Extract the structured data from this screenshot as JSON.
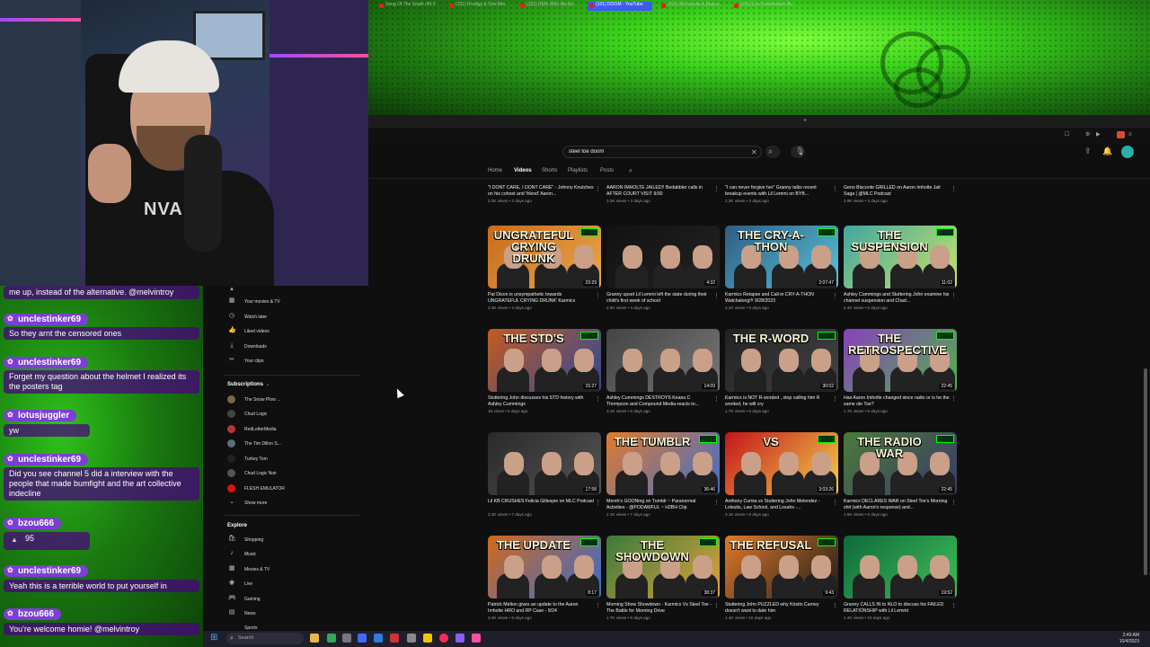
{
  "browser": {
    "tabs": [
      {
        "label": "Song Of The South (4K F"
      },
      {
        "label": "(101) Prodigy & Tom Mor"
      },
      {
        "label": "(101) DMX-Who We Be -"
      },
      {
        "label": "(101) DOOM - YouTube"
      },
      {
        "label": "(101) Minnesota is Basica"
      },
      {
        "label": "(101) Eye Examination Bu"
      }
    ]
  },
  "search": {
    "value": "steel toe doom"
  },
  "channel_tabs": [
    "Home",
    "Videos",
    "Shorts",
    "Playlists",
    "Posts"
  ],
  "sidebar": {
    "you_items": [
      "Your movies & TV",
      "Watch later",
      "Liked videos",
      "Downloads",
      "Your clips"
    ],
    "subscriptions_title": "Subscriptions",
    "subscriptions": [
      "The Snow Plow ...",
      "Chud Logic",
      "RedLetterMedia",
      "The Tim Dillon S...",
      "Turkey Tom",
      "Chud Logic Noir",
      "FLESH EMULATOR"
    ],
    "show_more": "Show more",
    "explore_title": "Explore",
    "explore_items": [
      "Shopping",
      "Music",
      "Movies & TV",
      "Live",
      "Gaming",
      "News",
      "Sports"
    ]
  },
  "videos": [
    {
      "title": "\"I DONT CARE, I DONT CARE\" - Johnny Knutches on his cohost and 'friend' Aaron...",
      "meta": "3.3K views • 3 days ago",
      "thumb": "",
      "duration": ""
    },
    {
      "title": "AARON IMHOLTE JAILED!! Bedabbler calls in AFTER COURT VISIT 9/30",
      "meta": "3.3K views • 3 days ago",
      "thumb": "",
      "duration": ""
    },
    {
      "title": "\"I can never forgive her\" Granny talks recent breakup events with Lil Lemmi on BYB...",
      "meta": "2.3K views • 3 days ago",
      "thumb": "",
      "duration": ""
    },
    {
      "title": "Geno Bisconte GRILLED on Aaron Imholte Jail Saga | @MLC Podcast",
      "meta": "2.9K views • 3 days ago",
      "thumb": "",
      "duration": ""
    },
    {
      "title": "Pat Dixon is unsympathetic towards UNGRATEFUL CRYING DRUNK' Karmicx",
      "meta": "2.3K views • 4 days ago",
      "thumb": "UNGRATEFUL CRYING DRUNK",
      "duration": "23:29"
    },
    {
      "title": "Granny upset Lil Lemmi left the state during their child's first week of school",
      "meta": "2.6K views • 4 days ago",
      "thumb": "",
      "duration": "4:32"
    },
    {
      "title": "Karmicx Relapse and Call-in CRY-A-THON Watchalong!!! 9/28/2023",
      "meta": "3.2K views • 5 days ago",
      "thumb": "THE CRY-A-THON",
      "duration": "2:07:47"
    },
    {
      "title": "Ashley Cummings and Stuttering John examine his channel suspension and Chad...",
      "meta": "2.4K views • 5 days ago",
      "thumb": "THE SUSPENSION",
      "duration": "11:02"
    },
    {
      "title": "Stuttering John discusses his STD history with Ashley Cummings",
      "meta": "16 views • 5 days ago",
      "thumb": "THE STD'S",
      "duration": "15:27"
    },
    {
      "title": "Ashley Cummings DESTROYS Keanu C Thompson and Compound Media-reacts to...",
      "meta": "3.1K views • 6 days ago",
      "thumb": "",
      "duration": "14:09"
    },
    {
      "title": "Karmicx is NOT R-worded , stop calling him R worded, he will cry",
      "meta": "1.7K views • 6 days ago",
      "thumb": "THE R-WORD",
      "duration": "30:02"
    },
    {
      "title": "Has Aaron Imholte changed since radio or is he the same ole Toe?",
      "meta": "1.7K views • 6 days ago",
      "thumb": "THE RETROSPECTIVE",
      "duration": "22:45"
    },
    {
      "title": "Lil KB CRUSHES Felicia Gillespie on MLC Podcast",
      "meta": "2.3K views • 7 days ago",
      "thumb": "",
      "duration": "17:58"
    },
    {
      "title": "Mersh's GOONing on Tumblr ~ Paranormal Activities - @PODAWFUL ~ H2BH Clip",
      "meta": "2.1K views • 7 days ago",
      "thumb": "THE TUMBLR",
      "duration": "36:46"
    },
    {
      "title": "Anthony Cumia vs Stuttering John Melendez - Lolsuits, Law School, and Losahs -...",
      "meta": "3.1K views • 8 days ago",
      "thumb": "VS",
      "duration": "3:03:26"
    },
    {
      "title": "Karmicx DECLARES WAR on Steel Toe's Morning shit (with Aaron's response) and...",
      "meta": "1.8K views • 8 days ago",
      "thumb": "THE RADIO WAR",
      "duration": "22:45"
    },
    {
      "title": "Patrick Melton gives an update to the Aaron Imholte HRO and RP Case - 9/24",
      "meta": "2.4K views • 9 days ago",
      "thumb": "THE UPDATE",
      "duration": "8:17"
    },
    {
      "title": "Morning Show Showdown - Karmicx Vs Steel Toe - The Battle for Morning Drive",
      "meta": "1.7K views • 9 days ago",
      "thumb": "THE SHOWDOWN",
      "duration": "38:37"
    },
    {
      "title": "Stuttering John PUZZLED why Kristin Carney doesn't want to date him",
      "meta": "1.4K views • 10 days ago",
      "thumb": "THE REFUSAL",
      "duration": "9:43"
    },
    {
      "title": "Granny CALLS IN to NLO to discuss his FAILED RELATIONSHIP with Lil Lemmi",
      "meta": "1.4K views • 10 days ago",
      "thumb": "",
      "duration": "19:52"
    }
  ],
  "chat": [
    {
      "user": "",
      "message": "me up, instead of the alternative. @melvintroy"
    },
    {
      "user": "unclestinker69",
      "message": "So they arnt the censored ones"
    },
    {
      "user": "unclestinker69",
      "message": "Forget my question about the helmet I realized its the posters tag"
    },
    {
      "user": "lotusjuggler",
      "message": "yw"
    },
    {
      "user": "unclestinker69",
      "message": "Did you see channel 5 did a interview with the people that made bumfight and the art collective indecline"
    },
    {
      "user": "bzou666",
      "message": "95"
    },
    {
      "user": "unclestinker69",
      "message": "Yeah this is a terrible world to put yourself in"
    },
    {
      "user": "bzou666",
      "message": "You're welcome homie! @melvintroy"
    }
  ],
  "stream_overlay": {
    "shirt_text": "NVADIS"
  },
  "taskbar": {
    "search_placeholder": "Search",
    "time": "2:49 AM",
    "date": "10/4/2023"
  },
  "colors": {
    "yt_bg": "#0f0f0f",
    "chat_purple": "#4b0082",
    "banner_green": "#3ad11c",
    "active_tab": "#3a5cf0"
  }
}
